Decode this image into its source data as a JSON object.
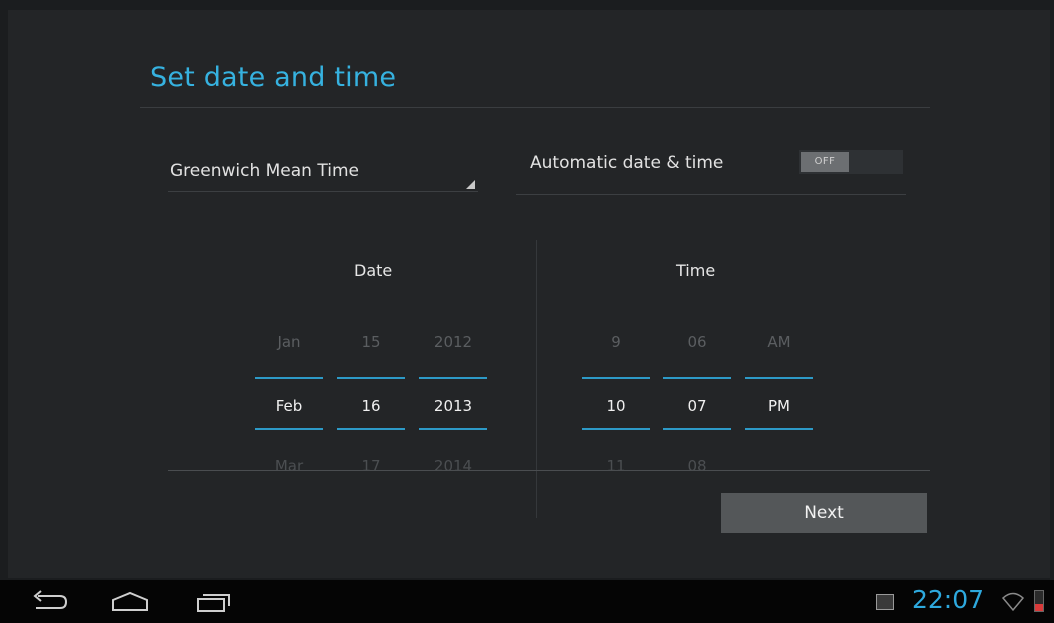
{
  "header": {
    "title": "Set date and time"
  },
  "timezone": {
    "selected": "Greenwich Mean Time"
  },
  "auto_datetime": {
    "label": "Automatic date & time",
    "toggle_state": "OFF"
  },
  "date": {
    "heading": "Date",
    "month": {
      "prev": "Jan",
      "current": "Feb",
      "next": "Mar"
    },
    "day": {
      "prev": "15",
      "current": "16",
      "next": "17"
    },
    "year": {
      "prev": "2012",
      "current": "2013",
      "next": "2014"
    }
  },
  "time": {
    "heading": "Time",
    "hour": {
      "prev": "9",
      "current": "10",
      "next": "11"
    },
    "minute": {
      "prev": "06",
      "current": "07",
      "next": "08"
    },
    "ampm": {
      "prev": "AM",
      "current": "PM"
    }
  },
  "actions": {
    "next_label": "Next"
  },
  "status_bar": {
    "clock": "22:07",
    "icons": [
      "back-icon",
      "home-icon",
      "recent-apps-icon",
      "gallery-icon",
      "wifi-icon",
      "battery-icon"
    ],
    "accent_color": "#2ea9de",
    "battery_level": 0.35
  },
  "colors": {
    "accent": "#36b2e0",
    "picker_line": "#2d9ac7",
    "background": "#232527"
  }
}
